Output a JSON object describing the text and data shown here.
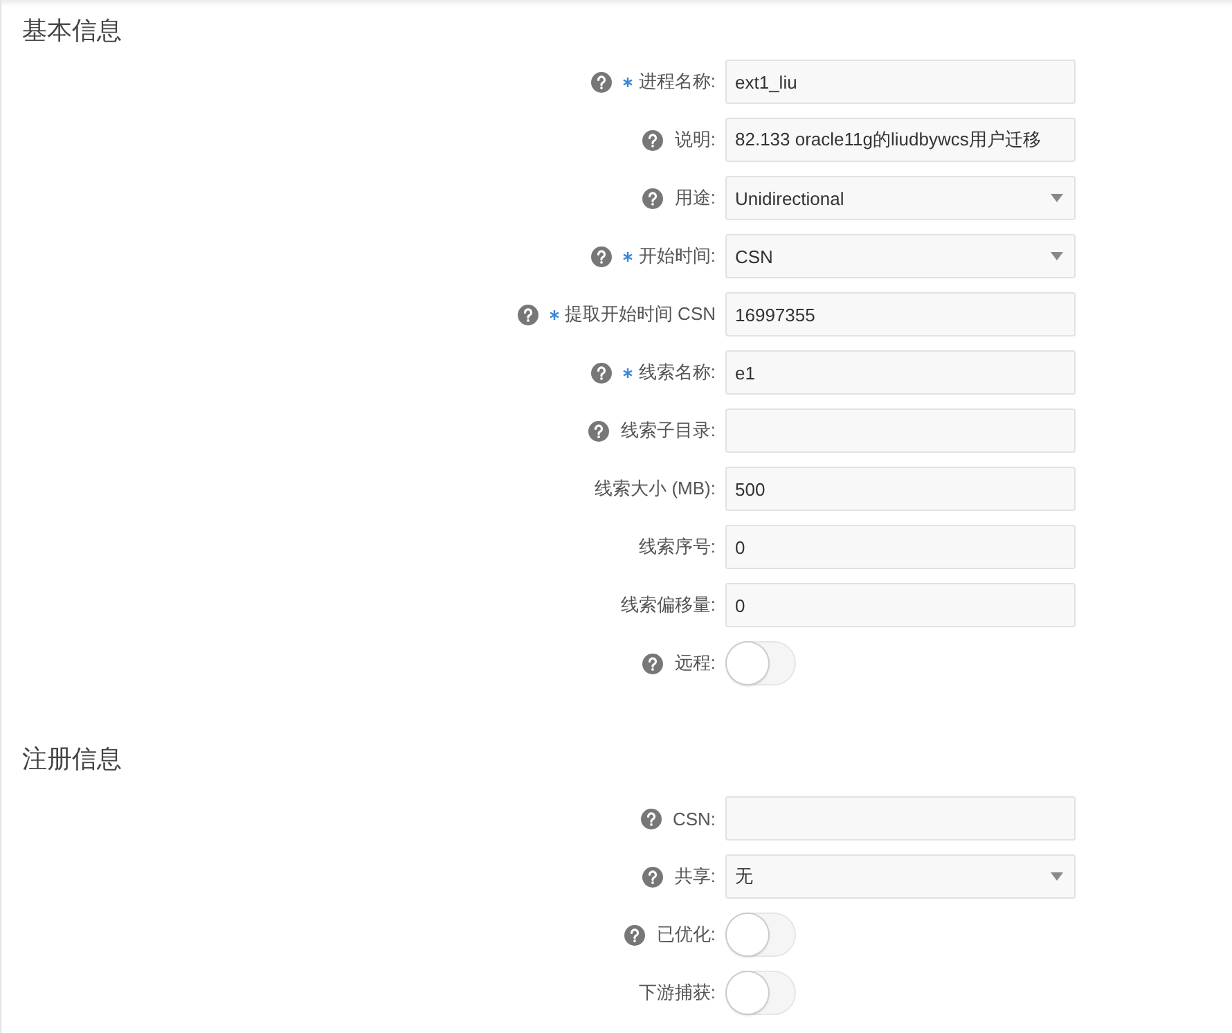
{
  "sections": [
    {
      "title": "基本信息",
      "rows": [
        {
          "kind": "text",
          "help": true,
          "required": true,
          "label": "进程名称:",
          "value": "ext1_liu"
        },
        {
          "kind": "text",
          "help": true,
          "required": false,
          "label": "说明:",
          "value": "82.133 oracle11g的liudbywcs用户迁移"
        },
        {
          "kind": "select",
          "help": true,
          "required": false,
          "label": "用途:",
          "value": "Unidirectional"
        },
        {
          "kind": "select",
          "help": true,
          "required": true,
          "label": "开始时间:",
          "value": "CSN"
        },
        {
          "kind": "text",
          "help": true,
          "required": true,
          "label": "提取开始时间 CSN",
          "value": "16997355"
        },
        {
          "kind": "text",
          "help": true,
          "required": true,
          "label": "线索名称:",
          "value": "e1"
        },
        {
          "kind": "text",
          "help": true,
          "required": false,
          "label": "线索子目录:"
        },
        {
          "kind": "text",
          "help": false,
          "required": false,
          "label": "线索大小 (MB):",
          "value": "500"
        },
        {
          "kind": "text",
          "help": false,
          "required": false,
          "label": "线索序号:",
          "value": "0"
        },
        {
          "kind": "text",
          "help": false,
          "required": false,
          "label": "线索偏移量:",
          "value": "0"
        },
        {
          "kind": "switch",
          "help": true,
          "required": false,
          "label": "远程:",
          "on": false
        }
      ]
    },
    {
      "title": "注册信息",
      "rows": [
        {
          "kind": "text",
          "help": true,
          "required": false,
          "label": "CSN:"
        },
        {
          "kind": "select",
          "help": true,
          "required": false,
          "label": "共享:",
          "value": "无"
        },
        {
          "kind": "switch",
          "help": true,
          "required": false,
          "label": "已优化:",
          "on": false
        },
        {
          "kind": "switch",
          "help": false,
          "required": false,
          "label": "下游捕获:",
          "on": false
        }
      ]
    }
  ]
}
